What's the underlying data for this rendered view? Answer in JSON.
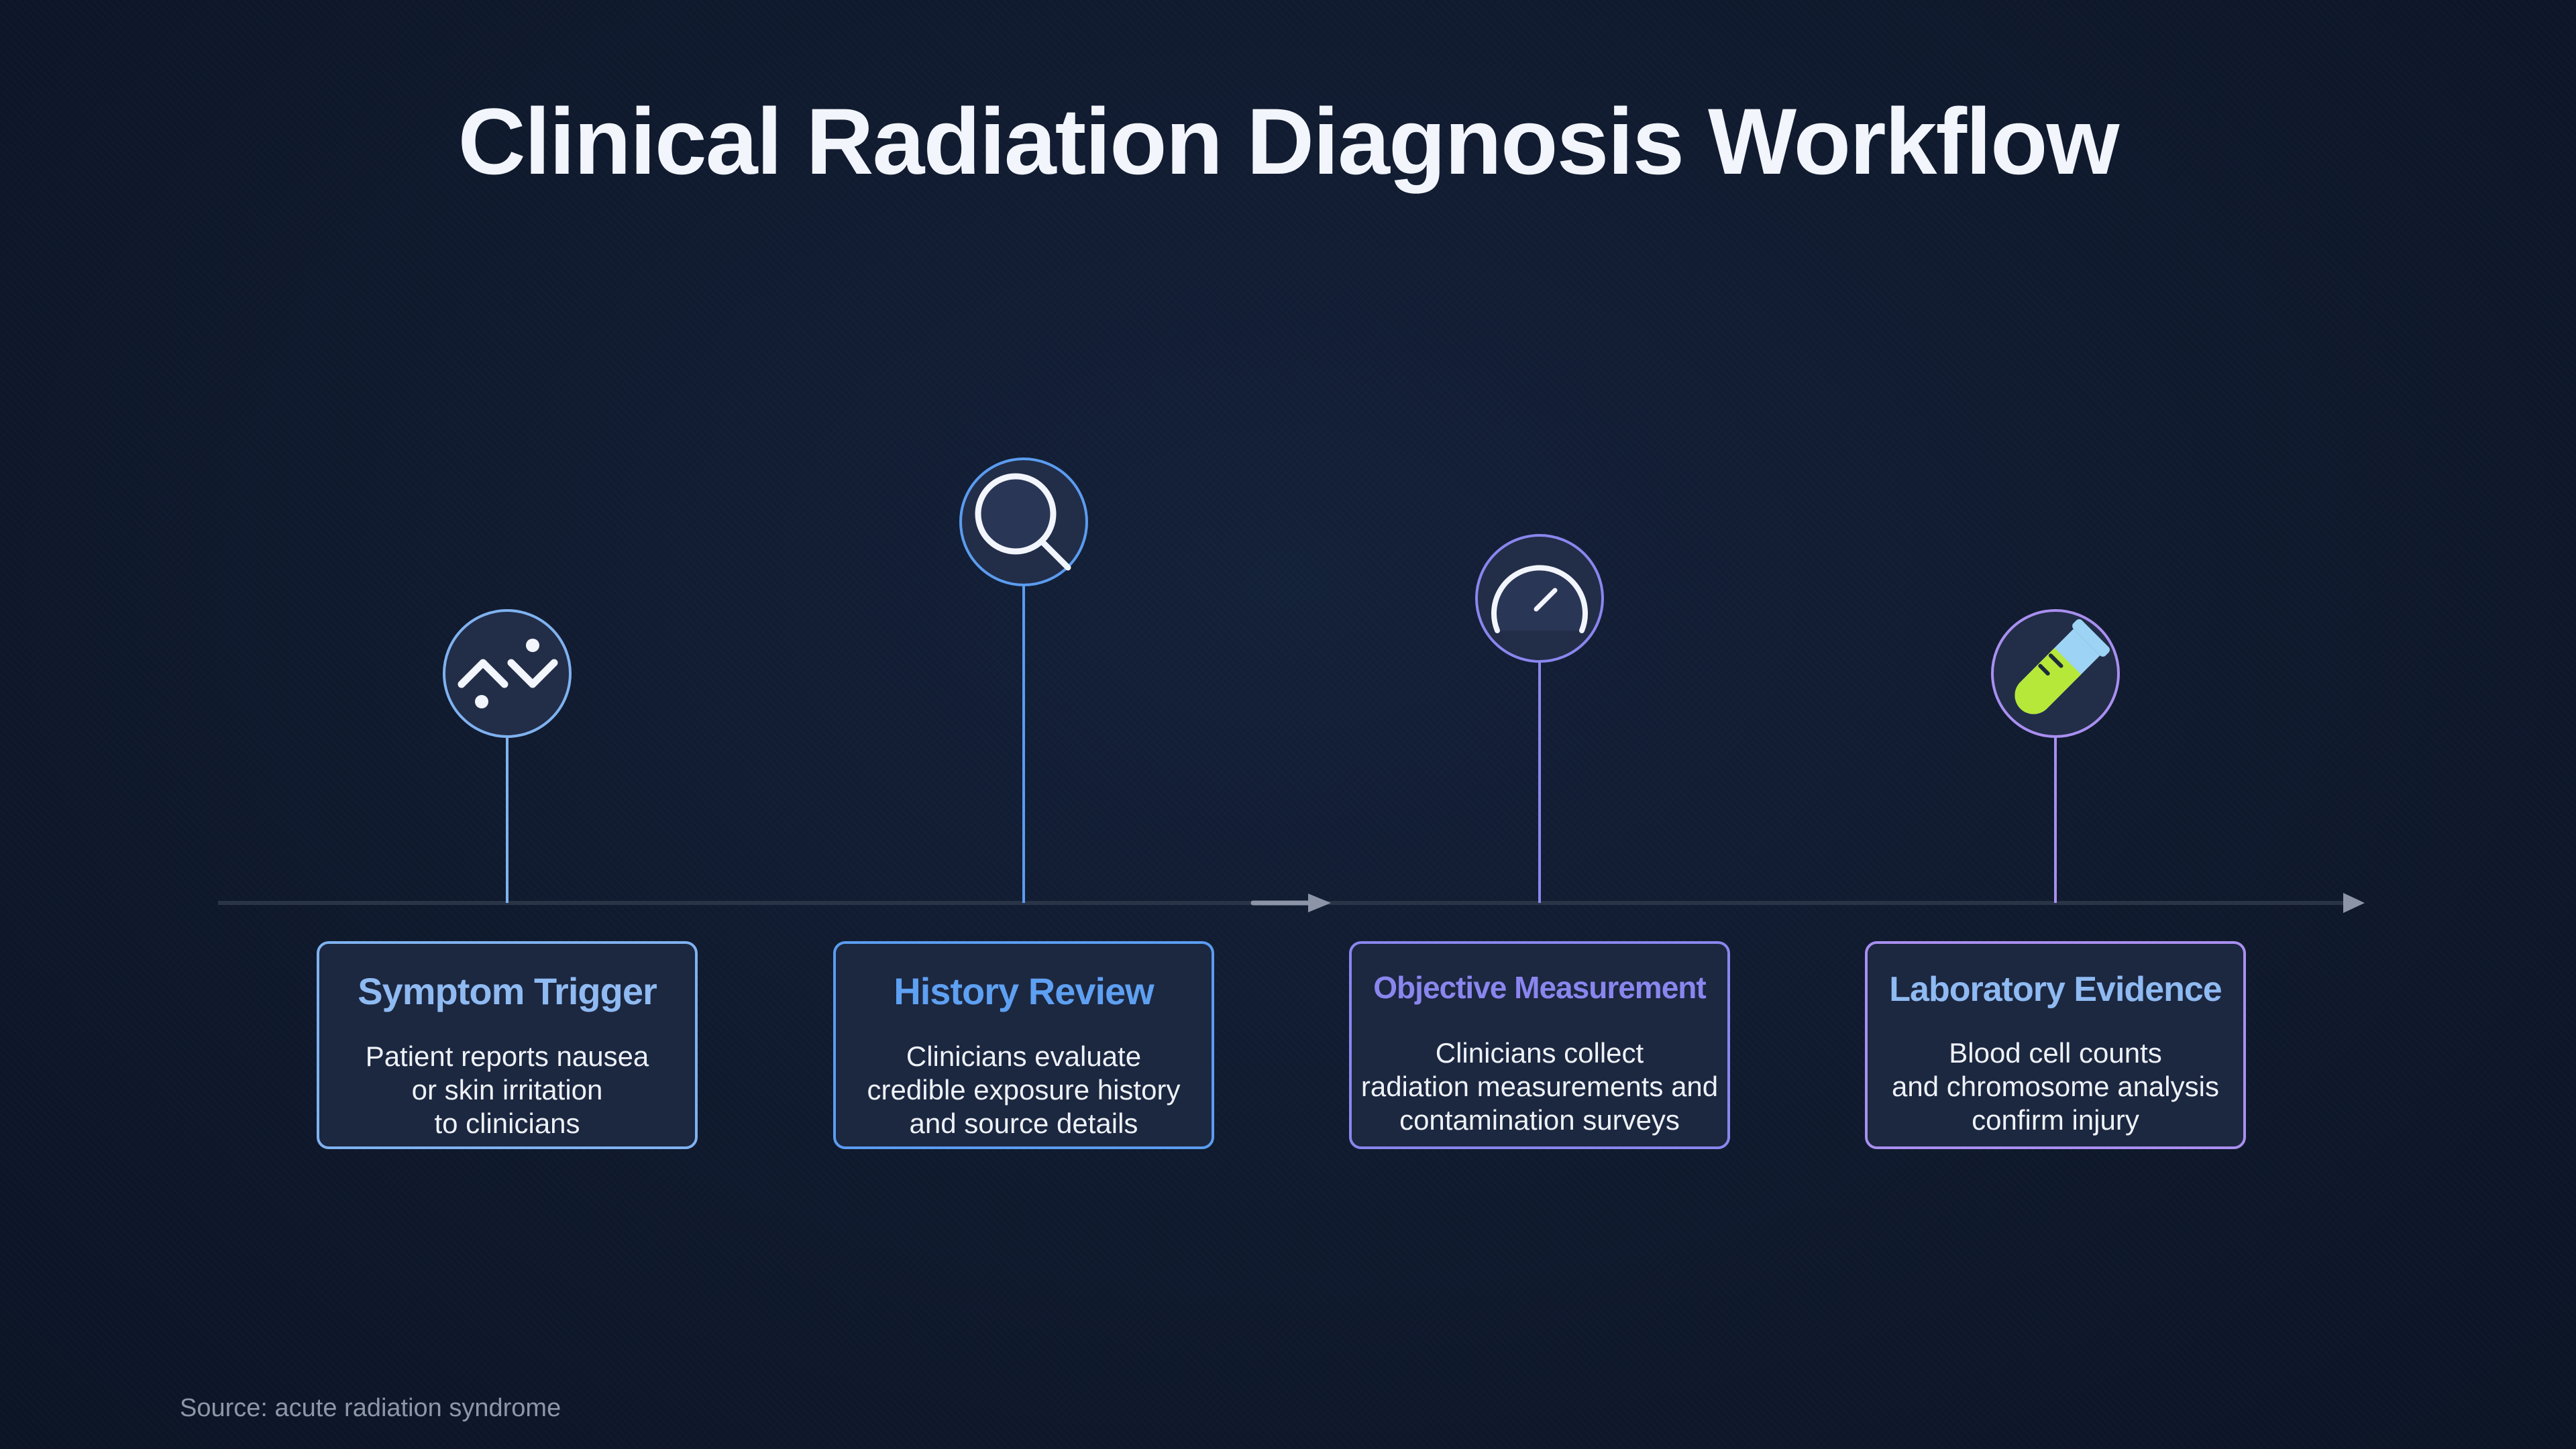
{
  "title": "Clinical Radiation Diagnosis Workflow",
  "source": "Source: acute radiation syndrome",
  "colors": {
    "background": "#101a2e",
    "axis": "#2a3447",
    "axis_arrow": "#8b95a7",
    "step1": "#7fb2f0",
    "step2": "#5b9cf0",
    "step3": "#8a86ee",
    "step4": "#a98ff0",
    "icon_fill": "#222d48",
    "icon_glyph": "#f2f5fb",
    "tube_green": "#b6e83a",
    "tube_blue": "#9dd3f4"
  },
  "steps": [
    {
      "title": "Symptom Trigger",
      "body": "Patient reports nausea\nor skin irritation\nto clinicians",
      "icon": "symptom-zigzag-icon"
    },
    {
      "title": "History Review",
      "body": "Clinicians evaluate\ncredible exposure history\nand source details",
      "icon": "magnifier-icon"
    },
    {
      "title": "Objective Measurement",
      "body": "Clinicians collect\nradiation measurements and\ncontamination surveys",
      "icon": "gauge-icon"
    },
    {
      "title": "Laboratory Evidence",
      "body": "Blood cell counts\nand chromosome analysis\nconfirm injury",
      "icon": "test-tube-icon"
    }
  ]
}
